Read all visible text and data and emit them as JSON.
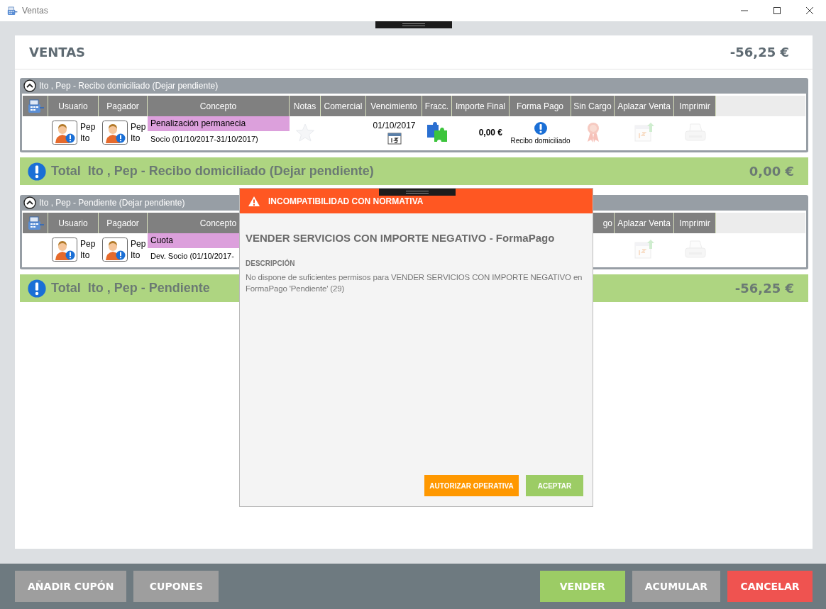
{
  "window": {
    "title": "Ventas"
  },
  "panel": {
    "title": "VENTAS",
    "total": "-56,25 €"
  },
  "groups": [
    {
      "title": "Ito , Pep - Recibo domiciliado (Dejar pendiente)",
      "expanded": true,
      "columns": [
        {
          "kind": "register"
        },
        {
          "kind": "user",
          "label": "Usuario"
        },
        {
          "kind": "payer",
          "label": "Pagador"
        },
        {
          "kind": "concept",
          "label": "Concepto"
        },
        {
          "kind": "notes",
          "label": "Notas"
        },
        {
          "kind": "commercial",
          "label": "Comercial"
        },
        {
          "kind": "due",
          "label": "Vencimiento"
        },
        {
          "kind": "split",
          "label": "Fracc."
        },
        {
          "kind": "amount",
          "label": "Importe Final"
        },
        {
          "kind": "payment",
          "label": "Forma Pago"
        },
        {
          "kind": "free",
          "label": "Sin Cargo"
        },
        {
          "kind": "postpone",
          "label": "Aplazar Venta"
        },
        {
          "kind": "print",
          "label": "Imprimir"
        }
      ],
      "rows": [
        {
          "cells": [
            {
              "kind": "empty"
            },
            {
              "kind": "person",
              "first": "Pep",
              "last": "Ito"
            },
            {
              "kind": "person",
              "first": "Pep",
              "last": "Ito"
            },
            {
              "kind": "concept",
              "title": "Penalización permanecia",
              "detail": "Socio (01/10/2017-31/10/2017)"
            },
            {
              "kind": "notes",
              "disabled": true
            },
            {
              "kind": "empty"
            },
            {
              "kind": "date",
              "text": "01/10/2017"
            },
            {
              "kind": "split"
            },
            {
              "kind": "amount",
              "text": "0,00 €"
            },
            {
              "kind": "payment",
              "text": "Recibo domiciliado"
            },
            {
              "kind": "free",
              "disabled": true
            },
            {
              "kind": "postpone",
              "disabled": true
            },
            {
              "kind": "print",
              "disabled": true
            }
          ]
        }
      ],
      "total": {
        "label": "Total  Ito , Pep - Recibo domiciliado (Dejar pendiente)",
        "amount": "0,00 €"
      }
    },
    {
      "title": "Ito , Pep - Pendiente (Dejar pendiente)",
      "expanded": true,
      "columns": [
        {
          "kind": "register"
        },
        {
          "kind": "user",
          "label": "Usuario"
        },
        {
          "kind": "payer",
          "label": "Pagador"
        },
        {
          "kind": "concept",
          "label": "Concepto"
        },
        {
          "kind": "partial",
          "label": "go"
        },
        {
          "kind": "postpone",
          "label": "Aplazar Venta"
        },
        {
          "kind": "print",
          "label": "Imprimir"
        }
      ],
      "rows": [
        {
          "cells": [
            {
              "kind": "empty"
            },
            {
              "kind": "person",
              "first": "Pep",
              "last": "Ito"
            },
            {
              "kind": "person",
              "first": "Pep",
              "last": "Ito"
            },
            {
              "kind": "concept",
              "title": "Cuota",
              "detail": "Dev. Socio (01/10/2017-"
            },
            {
              "kind": "empty"
            },
            {
              "kind": "postpone",
              "disabled": true
            },
            {
              "kind": "print",
              "disabled": true
            }
          ]
        }
      ],
      "total": {
        "label": "Total  Ito , Pep - Pendiente",
        "amount": "-56,25 €"
      }
    }
  ],
  "dialog": {
    "title": "INCOMPATIBILIDAD CON NORMATIVA",
    "heading": "VENDER SERVICIOS CON IMPORTE NEGATIVO - FormaPago",
    "section": "DESCRIPCIÓN",
    "message": "No dispone de suficientes permisos para VENDER SERVICIOS CON IMPORTE NEGATIVO en FormaPago 'Pendiente' (29)",
    "buttons": [
      {
        "label": "AUTORIZAR OPERATIVA",
        "kind": "warning"
      },
      {
        "label": "ACEPTAR",
        "kind": "confirm"
      }
    ]
  },
  "footer": {
    "left_buttons": [
      {
        "label": "AÑADIR CUPÓN",
        "kind": "neutral"
      },
      {
        "label": "CUPONES",
        "kind": "neutral"
      }
    ],
    "right_buttons": [
      {
        "label": "VENDER",
        "kind": "confirm"
      },
      {
        "label": "ACUMULAR",
        "kind": "neutral"
      },
      {
        "label": "CANCELAR",
        "kind": "danger"
      }
    ]
  }
}
